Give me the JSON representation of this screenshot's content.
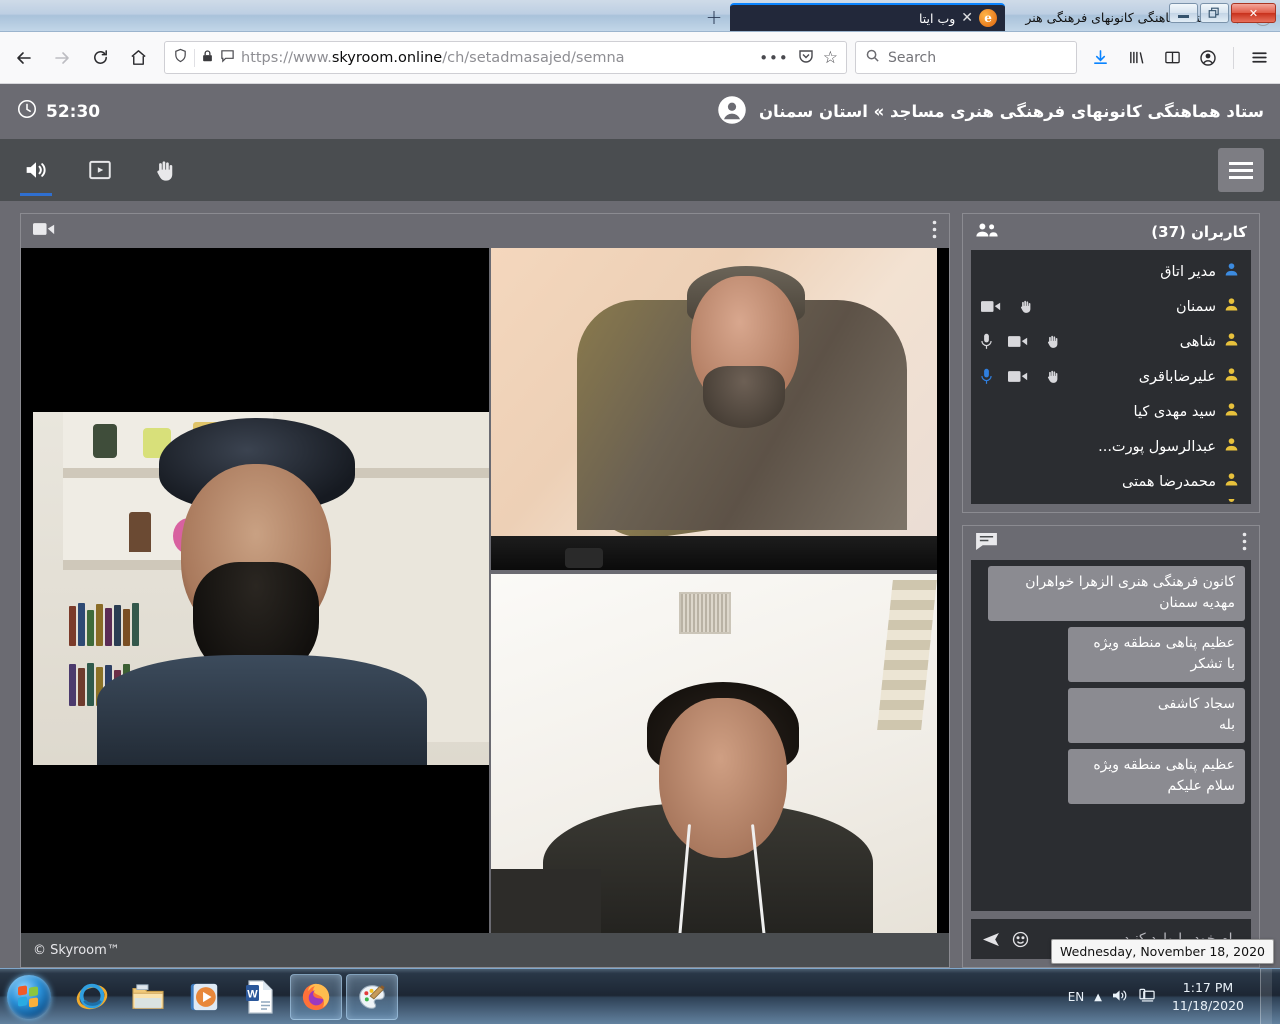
{
  "browser": {
    "tabs": [
      {
        "title": "ستاد هماهنگی کانونهای فرهنگی هنر",
        "favicon": "person-icon",
        "audio": "speaker-icon",
        "close": "✕",
        "active": false
      },
      {
        "title": "وب ایتا",
        "favicon": "eitaa-icon",
        "close": "✕",
        "active": true
      }
    ],
    "new_tab_label": "+",
    "window_controls": {
      "minimize": "minimize-icon",
      "maximize": "❐",
      "close": "✕"
    },
    "nav": {
      "back": "←",
      "forward": "→",
      "reload": "⟳",
      "home": "⌂"
    },
    "url": {
      "scheme": "https://www.",
      "domain": "skyroom.online",
      "path": "/ch/setadmasajed/semna"
    },
    "url_icons": {
      "shield": "shield-icon",
      "lock": "lock-icon",
      "permissions": "page-info-icon",
      "more": "•••",
      "pocket": "pocket-icon",
      "bookmark": "☆"
    },
    "search": {
      "placeholder": "Search",
      "icon": "search-icon"
    },
    "toolbar_icons": [
      "download-icon",
      "library-icon",
      "sidebar-icon",
      "account-icon",
      "menu-icon"
    ]
  },
  "app": {
    "header": {
      "timer": "52:30",
      "timer_icon": "clock-icon",
      "room_title": "ستاد هماهنگی کانونهای فرهنگی هنری مساجد » استان سمنان",
      "account_icon": "user-circle-icon"
    },
    "toolbar": {
      "items": [
        {
          "name": "speaker-icon",
          "active": true
        },
        {
          "name": "screen-share-icon",
          "active": false
        },
        {
          "name": "raise-hand-icon",
          "active": false
        }
      ],
      "menu_label": "menu-icon"
    },
    "video_panel": {
      "camera_icon": "camera-icon",
      "options_icon": "kebab-menu-icon"
    },
    "footer": "© Skyroom™"
  },
  "users": {
    "title": "کاربران (37)",
    "icon": "people-icon",
    "rows": [
      {
        "name": "مدیر اتاق",
        "role": "admin",
        "hand": false,
        "camera": false,
        "mic": "none"
      },
      {
        "name": "سمنان",
        "role": "member",
        "hand": true,
        "camera": true,
        "mic": "none"
      },
      {
        "name": "شاهی",
        "role": "member",
        "hand": true,
        "camera": true,
        "mic": "off"
      },
      {
        "name": "علیرضاباقری",
        "role": "member",
        "hand": true,
        "camera": true,
        "mic": "on"
      },
      {
        "name": "سید مهدی کیا",
        "role": "member",
        "hand": false,
        "camera": false,
        "mic": "none"
      },
      {
        "name": "عبدالرسول پورت...",
        "role": "member",
        "hand": false,
        "camera": false,
        "mic": "none"
      },
      {
        "name": "محمدرضا همتی",
        "role": "member",
        "hand": false,
        "camera": false,
        "mic": "none"
      }
    ]
  },
  "chat": {
    "icon": "chat-icon",
    "options_icon": "kebab-menu-icon",
    "messages": [
      {
        "sender": "کانون فرهنگی هنری الزهرا خواهران",
        "text": "مهدیه سمنان",
        "width": "wide"
      },
      {
        "sender": "عظیم پناهی منطقه ویژه",
        "text": "با تشکر",
        "width": "narrow"
      },
      {
        "sender": "سجاد کاشفی",
        "text": "بله",
        "width": "narrow"
      },
      {
        "sender": "عظیم پناهی منطقه ویژه",
        "text": "سلام علیکم",
        "width": "narrow"
      }
    ],
    "input_placeholder": "پیام خود را وارد کنید",
    "emoji_icon": "emoji-icon",
    "send_icon": "send-icon"
  },
  "desktop": {
    "start_label": "start-orb",
    "taskbar_items": [
      {
        "name": "internet-explorer-icon",
        "open": false
      },
      {
        "name": "file-explorer-icon",
        "open": false
      },
      {
        "name": "windows-media-player-icon",
        "open": false
      },
      {
        "name": "microsoft-word-icon",
        "open": false
      },
      {
        "name": "firefox-icon",
        "open": true
      },
      {
        "name": "paint-icon",
        "open": true
      }
    ],
    "tray": {
      "language": "EN",
      "show_hidden_icon": "▲",
      "volume_icon": "volume-icon",
      "network_icon": "network-icon",
      "time": "1:17 PM",
      "date": "11/18/2020",
      "tooltip": "Wednesday, November 18, 2020"
    }
  },
  "colors": {
    "accent_blue": "#0a84ff",
    "app_header": "#6b6b72",
    "app_toolbar": "#4a4d50",
    "panel_dark": "#2b2d31",
    "admin_user": "#3c8be0",
    "member_user": "#e8c13c",
    "mic_on": "#2f7fe0"
  }
}
